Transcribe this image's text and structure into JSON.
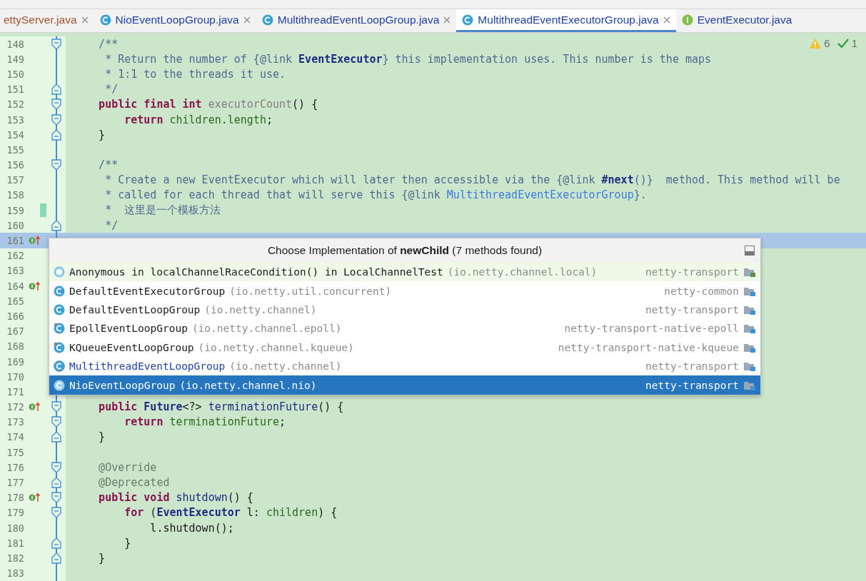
{
  "tabs": [
    {
      "label": "ettyServer.java",
      "kind": "plain",
      "modified": true,
      "selected": false,
      "closable": true
    },
    {
      "label": "NioEventLoopGroup.java",
      "kind": "class",
      "modified": false,
      "selected": false,
      "closable": true
    },
    {
      "label": "MultithreadEventLoopGroup.java",
      "kind": "class",
      "modified": false,
      "selected": false,
      "closable": true
    },
    {
      "label": "MultithreadEventExecutorGroup.java",
      "kind": "class",
      "modified": false,
      "selected": true,
      "closable": true
    },
    {
      "label": "EventExecutor.java",
      "kind": "interface",
      "modified": false,
      "selected": false,
      "closable": false
    }
  ],
  "inspections": {
    "warnings": "6",
    "passed": "1"
  },
  "lines": [
    {
      "number": "148",
      "fold_start": true,
      "tokens": [
        {
          "t": "    /**",
          "kind": "comment"
        }
      ]
    },
    {
      "number": "149",
      "tokens": [
        {
          "t": "     * Return the number of {",
          "kind": "comment"
        },
        {
          "t": "@link",
          "kind": "doctag"
        },
        {
          "t": " EventExecutor",
          "kind": "docref"
        },
        {
          "t": "} this implementation uses. This number is the maps",
          "kind": "comment"
        }
      ]
    },
    {
      "number": "150",
      "tokens": [
        {
          "t": "     * 1:1 to the threads it use.",
          "kind": "comment"
        }
      ]
    },
    {
      "number": "151",
      "fold_end": true,
      "tokens": [
        {
          "t": "     */",
          "kind": "comment"
        }
      ]
    },
    {
      "number": "152",
      "fold_start": true,
      "tokens": [
        {
          "t": "    public final int",
          "kind": "keyword"
        },
        {
          "t": " executorCount",
          "kind": "unused"
        },
        {
          "t": "() {",
          "kind": "plain"
        }
      ]
    },
    {
      "number": "153",
      "fold_start": true,
      "tokens": [
        {
          "t": "        return",
          "kind": "keyword"
        },
        {
          "t": " children.length",
          "kind": "field"
        },
        {
          "t": ";",
          "kind": "plain"
        }
      ]
    },
    {
      "number": "154",
      "fold_end": true,
      "tokens": [
        {
          "t": "    }",
          "kind": "plain"
        }
      ]
    },
    {
      "number": "155"
    },
    {
      "number": "156",
      "fold_start": true,
      "tokens": [
        {
          "t": "    /**",
          "kind": "comment"
        }
      ]
    },
    {
      "number": "157",
      "tokens": [
        {
          "t": "     * Create a new EventExecutor which will later then accessible via the {",
          "kind": "comment"
        },
        {
          "t": "@link",
          "kind": "doctag"
        },
        {
          "t": " #next",
          "kind": "docref"
        },
        {
          "t": "()}  method. This method will be",
          "kind": "comment"
        }
      ]
    },
    {
      "number": "158",
      "tokens": [
        {
          "t": "     * called for each thread that will serve this {",
          "kind": "comment"
        },
        {
          "t": "@link",
          "kind": "doctag"
        },
        {
          "t": " MultithreadEventExecutorGroup",
          "kind": "doclink"
        },
        {
          "t": "}.",
          "kind": "comment"
        }
      ]
    },
    {
      "number": "159",
      "changed": true,
      "tokens": [
        {
          "t": "     *  这里是一个模板方法",
          "kind": "comment"
        }
      ]
    },
    {
      "number": "160",
      "fold_end": true,
      "tokens": [
        {
          "t": "     */",
          "kind": "comment"
        }
      ]
    },
    {
      "number": "161",
      "current": true,
      "implements": true
    },
    {
      "number": "162"
    },
    {
      "number": "163"
    },
    {
      "number": "164",
      "implements": true
    },
    {
      "number": "165"
    },
    {
      "number": "166"
    },
    {
      "number": "167"
    },
    {
      "number": "168"
    },
    {
      "number": "169"
    },
    {
      "number": "170"
    },
    {
      "number": "171"
    },
    {
      "number": "172",
      "implements": true,
      "fold_start": true,
      "tokens": [
        {
          "t": "    public",
          "kind": "keyword"
        },
        {
          "t": " Future",
          "kind": "type"
        },
        {
          "t": "<?>",
          "kind": "plain"
        },
        {
          "t": " terminationFuture",
          "kind": "method"
        },
        {
          "t": "() {",
          "kind": "plain"
        }
      ]
    },
    {
      "number": "173",
      "fold_start": true,
      "tokens": [
        {
          "t": "        return",
          "kind": "keyword"
        },
        {
          "t": " terminationFuture",
          "kind": "field"
        },
        {
          "t": ";",
          "kind": "plain"
        }
      ]
    },
    {
      "number": "174",
      "fold_end": true,
      "tokens": [
        {
          "t": "    }",
          "kind": "plain"
        }
      ]
    },
    {
      "number": "175"
    },
    {
      "number": "176",
      "fold_start": true,
      "tokens": [
        {
          "t": "    @Override",
          "kind": "annotation"
        }
      ]
    },
    {
      "number": "177",
      "fold_end": true,
      "tokens": [
        {
          "t": "    @Deprecated",
          "kind": "annotation"
        }
      ]
    },
    {
      "number": "178",
      "implements": true,
      "fold_start": true,
      "tokens": [
        {
          "t": "    public void",
          "kind": "keyword"
        },
        {
          "t": " shutdown",
          "kind": "method"
        },
        {
          "t": "() {",
          "kind": "plain"
        }
      ]
    },
    {
      "number": "179",
      "fold_start": true,
      "tokens": [
        {
          "t": "        for",
          "kind": "keyword"
        },
        {
          "t": " (",
          "kind": "plain"
        },
        {
          "t": "EventExecutor",
          "kind": "type"
        },
        {
          "t": " l:",
          "kind": "plain"
        },
        {
          "t": " children",
          "kind": "field"
        },
        {
          "t": ") {",
          "kind": "plain"
        }
      ]
    },
    {
      "number": "180",
      "tokens": [
        {
          "t": "            l.shutdown();",
          "kind": "plain"
        }
      ]
    },
    {
      "number": "181",
      "fold_end": true,
      "tokens": [
        {
          "t": "        }",
          "kind": "plain"
        }
      ]
    },
    {
      "number": "182",
      "fold_end": true,
      "tokens": [
        {
          "t": "    }",
          "kind": "plain"
        }
      ]
    },
    {
      "number": "183"
    }
  ],
  "popup": {
    "title": "Choose Implementation of **newChild** (7 methods found)",
    "items": [
      {
        "kind": "anonymous",
        "name": "Anonymous in localChannelRaceCondition() in LocalChannelTest",
        "package": "(io.netty.channel.local)",
        "module": "netty-transport",
        "test": true,
        "abstract": false,
        "selected": false,
        "hovered": true
      },
      {
        "kind": "class",
        "name": "DefaultEventExecutorGroup",
        "package": "(io.netty.util.concurrent)",
        "module": "netty-common",
        "test": false,
        "abstract": false,
        "selected": false,
        "hovered": false
      },
      {
        "kind": "class",
        "name": "DefaultEventLoopGroup",
        "package": "(io.netty.channel)",
        "module": "netty-transport",
        "test": false,
        "abstract": false,
        "selected": false,
        "hovered": false
      },
      {
        "kind": "final",
        "name": "EpollEventLoopGroup",
        "package": "(io.netty.channel.epoll)",
        "module": "netty-transport-native-epoll",
        "test": false,
        "abstract": false,
        "selected": false,
        "hovered": false
      },
      {
        "kind": "final",
        "name": "KQueueEventLoopGroup",
        "package": "(io.netty.channel.kqueue)",
        "module": "netty-transport-native-kqueue",
        "test": false,
        "abstract": false,
        "selected": false,
        "hovered": false
      },
      {
        "kind": "abstract",
        "name": "MultithreadEventLoopGroup",
        "package": "(io.netty.channel)",
        "module": "netty-transport",
        "test": false,
        "abstract": true,
        "selected": false,
        "hovered": false
      },
      {
        "kind": "class",
        "name": "NioEventLoopGroup",
        "package": "(io.netty.channel.nio)",
        "module": "netty-transport",
        "test": false,
        "abstract": false,
        "selected": true,
        "hovered": false
      }
    ]
  }
}
